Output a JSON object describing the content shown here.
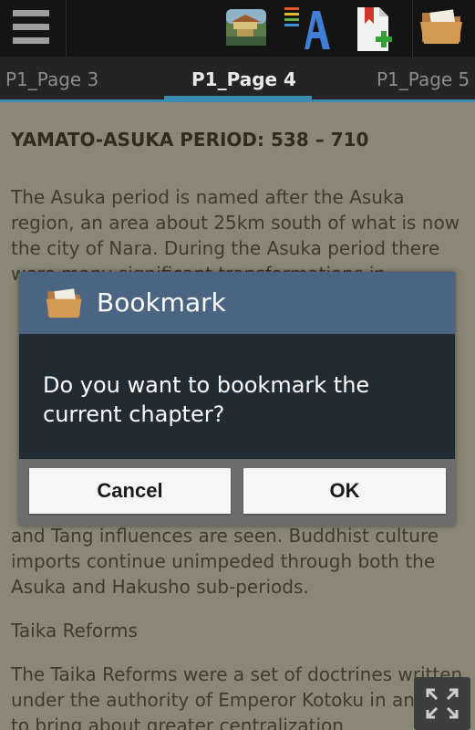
{
  "toolbar": {
    "menu_icon": "hamburger-menu-icon",
    "actions": [
      {
        "name": "scenery-image-icon"
      },
      {
        "name": "font-settings-icon"
      },
      {
        "name": "add-bookmark-icon"
      },
      {
        "name": "bookmarks-folder-icon"
      }
    ]
  },
  "tabs": {
    "prev": "P1_Page 3",
    "current": "P1_Page 4",
    "next": "P1_Page 5"
  },
  "article": {
    "heading": "YAMATO-ASUKA PERIOD: 538 – 710",
    "para1": "The Asuka period is named after the Asuka region, an area about 25km south of what is now the city of Nara. During the Asuka period there were many significant transformations in",
    "para1_cont": "and Tang influences are seen. Buddhist culture imports continue unimpeded through both the Asuka and Hakusho sub-periods.",
    "subheading": "Taika Reforms",
    "para2": "The Taika Reforms were a set of doctrines written under the authority of Emperor Kotoku in an effort to bring about greater centralization"
  },
  "dialog": {
    "title": "Bookmark",
    "message": "Do you want to bookmark the current chapter?",
    "cancel_label": "Cancel",
    "ok_label": "OK"
  },
  "colors": {
    "tab_accent": "#3b8bb0",
    "dialog_header": "#4b6482",
    "dialog_body": "#212b34"
  }
}
